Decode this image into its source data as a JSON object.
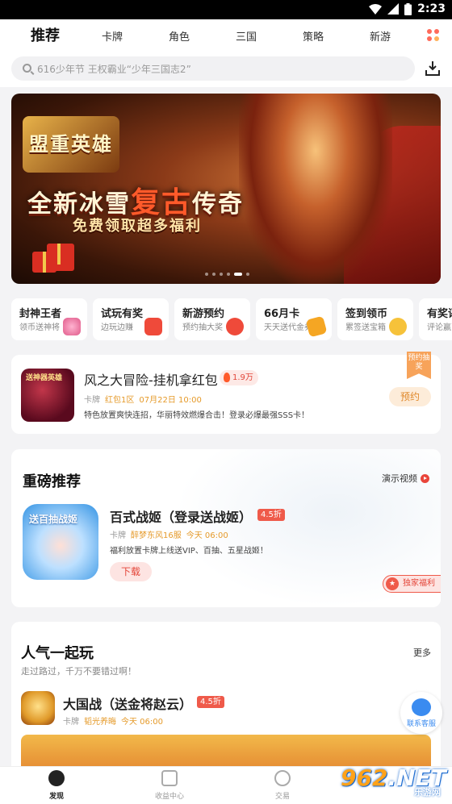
{
  "status_bar": {
    "time": "2:23"
  },
  "nav": {
    "tabs": [
      "推荐",
      "卡牌",
      "角色",
      "三国",
      "策略",
      "新游"
    ],
    "active": "推荐"
  },
  "search": {
    "placeholder": "616少年节 王权霸业“少年三国志2”"
  },
  "banner": {
    "logo_text": "盟重英雄",
    "headline_pre": "全新冰雪",
    "headline_mid": "复古",
    "headline_post": "传奇",
    "subline": "免费领取超多福利",
    "page_count": 6,
    "current_page": 5
  },
  "quick_entries": [
    {
      "title": "封神王者",
      "subtitle": "领币送神将",
      "icon": "character-icon"
    },
    {
      "title": "试玩有奖",
      "subtitle": "边玩边赚",
      "icon": "gift-box-icon"
    },
    {
      "title": "新游预约",
      "subtitle": "预约抽大奖",
      "icon": "gamepad-icon"
    },
    {
      "title": "66月卡",
      "subtitle": "天天送代金券",
      "icon": "coupon-icon"
    },
    {
      "title": "签到领币",
      "subtitle": "累签送宝箱",
      "icon": "coin-icon"
    },
    {
      "title": "有奖评",
      "subtitle": "评论赢币",
      "icon": "comment-icon"
    }
  ],
  "featured_game": {
    "thumb_text": "送神器英雄",
    "title": "风之大冒险-挂机拿红包",
    "heat": "1.9万",
    "category": "卡牌",
    "server": "红包1区",
    "time": "07月22日 10:00",
    "description": "特色放置爽快连招，华丽特效燃爆合击！登录必爆最强SSS卡！",
    "flag": "预约抽奖",
    "button": "预约"
  },
  "heavy_recommend": {
    "heading": "重磅推荐",
    "video_link": "演示视频",
    "thumb_text": "送百抽战姬",
    "title": "百式战姬（登录送战姬）",
    "discount": "4.5折",
    "category": "卡牌",
    "server": "醉梦东风16服",
    "time": "今天 06:00",
    "description": "福利放置卡牌上线送VIP、百抽、五星战姬！",
    "button": "下载",
    "perk": "独家福利"
  },
  "popular": {
    "heading": "人气一起玩",
    "more": "更多",
    "subtitle": "走过路过，千万不要错过啊！",
    "game": {
      "title": "大国战（送金将赵云）",
      "discount": "4.5折",
      "category": "卡牌",
      "server": "韬光养晦",
      "time": "今天 06:00"
    }
  },
  "customer_service": "联系客服",
  "tabbar": [
    {
      "label": "发现",
      "icon": "compass-icon",
      "active": true
    },
    {
      "label": "收益中心",
      "icon": "earnings-icon",
      "active": false
    },
    {
      "label": "交易",
      "icon": "trade-icon",
      "active": false
    },
    {
      "label": "",
      "icon": "",
      "active": false
    }
  ],
  "watermark": {
    "number": "962",
    "suffix": ".NET",
    "site": "乐游网"
  }
}
